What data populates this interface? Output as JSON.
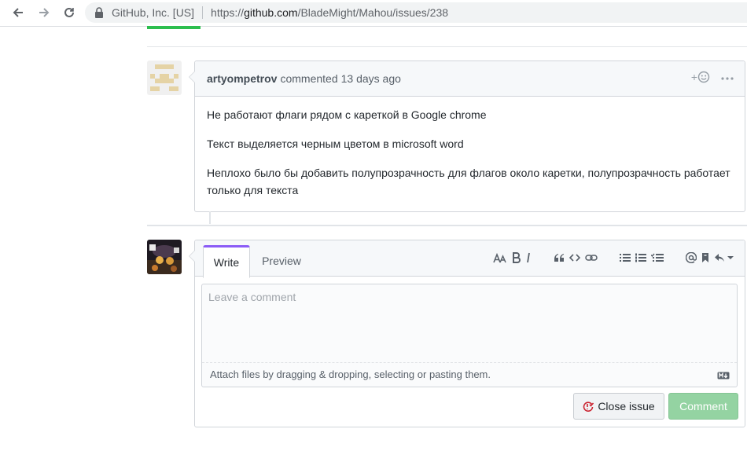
{
  "browser": {
    "site_identity": "GitHub, Inc. [US]",
    "url_prefix": "https://",
    "url_host": "github.com",
    "url_path": "/BladeMight/Mahou/issues/238"
  },
  "comment": {
    "author": "artyompetrov",
    "action": "commented",
    "time": "13 days ago",
    "reaction_plus": "+",
    "paragraphs": [
      "Не работают флаги рядом с кареткой в Google chrome",
      "Текст выделяется черным цветом в microsoft word",
      "Неплохо было бы добавить полупрозрачность для флагов около каретки, полупрозрачность работает только для текста"
    ]
  },
  "editor": {
    "tab_write": "Write",
    "tab_preview": "Preview",
    "placeholder": "Leave a comment",
    "attach_hint": "Attach files by dragging & dropping, selecting or pasting them.",
    "close_issue_label": "Close issue",
    "comment_label": "Comment"
  },
  "colors": {
    "accent_green": "#2cbe4e",
    "write_tab_accent": "#8b5cf6",
    "comment_button": "#94d3a2",
    "close_issue_icon": "#cb2431"
  }
}
